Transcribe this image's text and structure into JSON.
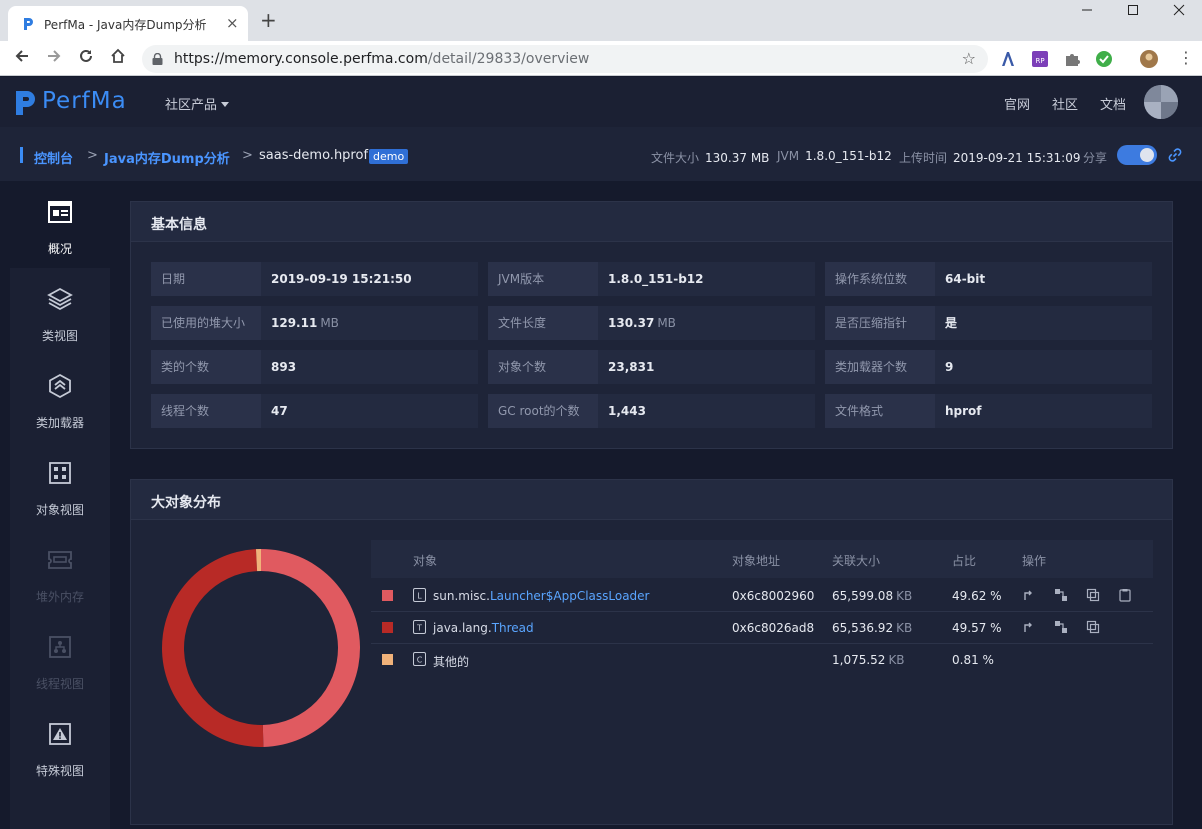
{
  "browser": {
    "tab_title": "PerfMa - Java内存Dump分析",
    "url_host": "https://memory.console.perfma.com",
    "url_path": "/detail/29833/overview",
    "tab_close_icon": "×",
    "new_tab_icon": "+",
    "extensions": [
      "a-icon",
      "rp-icon",
      "puzzle-icon",
      "check-icon",
      "avatar-icon"
    ]
  },
  "header": {
    "logo_text": "PerfMa",
    "community_menu": "社区产品",
    "links": [
      "官网",
      "社区",
      "文档"
    ]
  },
  "breadcrumb": {
    "console": "控制台",
    "sep1": ">",
    "analysis": "Java内存Dump分析",
    "sep2": ">",
    "file": "saas-demo.hprof",
    "badge": "demo"
  },
  "file_meta": {
    "size_label": "文件大小",
    "size_value": "130.37 MB",
    "jvm_label": "JVM",
    "jvm_value": "1.8.0_151-b12",
    "upload_label": "上传时间",
    "upload_value": "2019-09-21 15:31:09",
    "share_label": "分享",
    "share_enabled": true
  },
  "sidebar": {
    "items": [
      {
        "label": "概况",
        "icon": "overview-icon",
        "active": true,
        "enabled": true
      },
      {
        "label": "类视图",
        "icon": "layers-icon",
        "active": false,
        "enabled": true
      },
      {
        "label": "类加载器",
        "icon": "classloader-icon",
        "active": false,
        "enabled": true
      },
      {
        "label": "对象视图",
        "icon": "grid-icon",
        "active": false,
        "enabled": true
      },
      {
        "label": "堆外内存",
        "icon": "memory-card-icon",
        "active": false,
        "enabled": false
      },
      {
        "label": "线程视图",
        "icon": "thread-tree-icon",
        "active": false,
        "enabled": false
      },
      {
        "label": "特殊视图",
        "icon": "warning-icon",
        "active": false,
        "enabled": true
      }
    ]
  },
  "basic_info": {
    "title": "基本信息",
    "rows": [
      [
        {
          "k": "日期",
          "v": "2019-09-19 15:21:50",
          "u": ""
        },
        {
          "k": "JVM版本",
          "v": "1.8.0_151-b12",
          "u": ""
        },
        {
          "k": "操作系统位数",
          "v": "64-bit",
          "u": ""
        }
      ],
      [
        {
          "k": "已使用的堆大小",
          "v": "129.11",
          "u": "MB"
        },
        {
          "k": "文件长度",
          "v": "130.37",
          "u": "MB"
        },
        {
          "k": "是否压缩指针",
          "v": "是",
          "u": ""
        }
      ],
      [
        {
          "k": "类的个数",
          "v": "893",
          "u": ""
        },
        {
          "k": "对象个数",
          "v": "23,831",
          "u": ""
        },
        {
          "k": "类加载器个数",
          "v": "9",
          "u": ""
        }
      ],
      [
        {
          "k": "线程个数",
          "v": "47",
          "u": ""
        },
        {
          "k": "GC root的个数",
          "v": "1,443",
          "u": ""
        },
        {
          "k": "文件格式",
          "v": "hprof",
          "u": ""
        }
      ]
    ]
  },
  "big_objects": {
    "title": "大对象分布",
    "columns": {
      "object": "对象",
      "address": "对象地址",
      "retained": "关联大小",
      "percent": "占比",
      "ops": "操作"
    },
    "rows": [
      {
        "color": "#e05a60",
        "type": "L",
        "pkg": "sun.misc.",
        "cls": "Launcher$AppClassLoader",
        "address": "0x6c8002960",
        "size": "65,599.08",
        "unit": "KB",
        "percent": "49.62 %",
        "share": 49.62,
        "ops": 4
      },
      {
        "color": "#b82a26",
        "type": "T",
        "pkg": "java.lang.",
        "cls": "Thread",
        "address": "0x6c8026ad8",
        "size": "65,536.92",
        "unit": "KB",
        "percent": "49.57 %",
        "share": 49.57,
        "ops": 3
      },
      {
        "color": "#f0b27a",
        "type": "C",
        "pkg": "其他的",
        "cls": "",
        "address": "",
        "size": "1,075.52",
        "unit": "KB",
        "percent": "0.81 %",
        "share": 0.81,
        "ops": 0
      }
    ]
  }
}
